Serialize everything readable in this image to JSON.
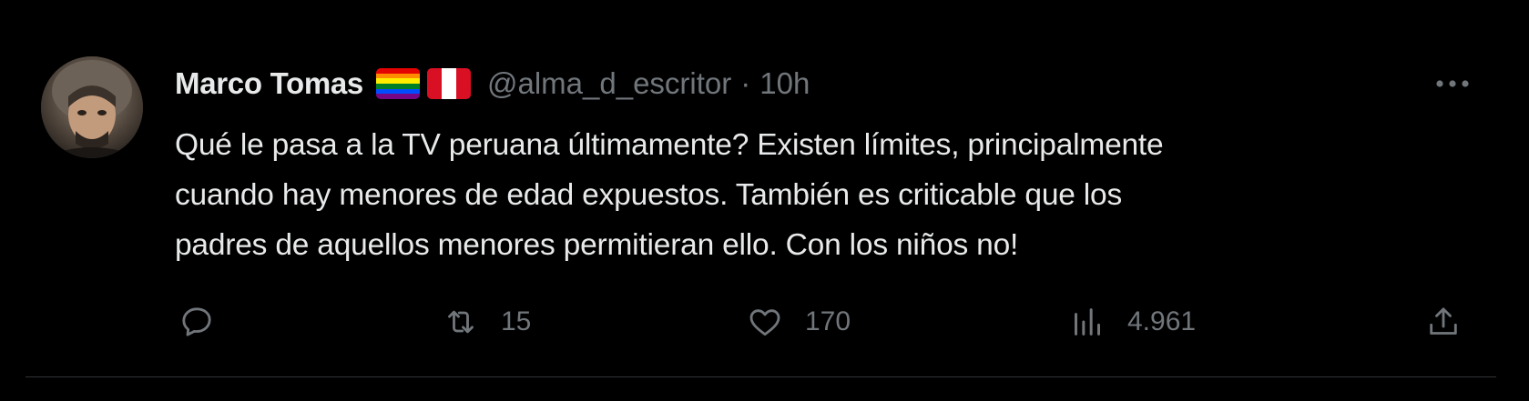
{
  "author": {
    "display_name": "Marco Tomas",
    "handle": "@alma_d_escritor",
    "separator": "·",
    "time": "10h",
    "avatar_icon": "avatar-photo"
  },
  "flags": [
    {
      "name": "rainbow-flag-icon",
      "colors": [
        "#e40303",
        "#ff8c00",
        "#ffed00",
        "#008026",
        "#004dff",
        "#750787"
      ]
    },
    {
      "name": "peru-flag-icon",
      "colors": [
        "#d91023",
        "#ffffff",
        "#d91023"
      ]
    }
  ],
  "tweet": {
    "lines": [
      "Qué le pasa a la TV peruana últimamente? Existen límites, principalmente",
      "cuando hay menores de edad expuestos. También es criticable que los",
      "padres de aquellos menores permitieran ello. Con los niños no!"
    ]
  },
  "actions": {
    "reply": {
      "icon": "reply-icon",
      "count": ""
    },
    "retweet": {
      "icon": "retweet-icon",
      "count": "15"
    },
    "like": {
      "icon": "heart-icon",
      "count": "170"
    },
    "views": {
      "icon": "views-icon",
      "count": "4.961"
    },
    "share": {
      "icon": "share-icon",
      "count": ""
    }
  },
  "colors": {
    "background": "#000000",
    "text_primary": "#e7e9ea",
    "text_secondary": "#71767b",
    "divider": "#2f3336"
  }
}
